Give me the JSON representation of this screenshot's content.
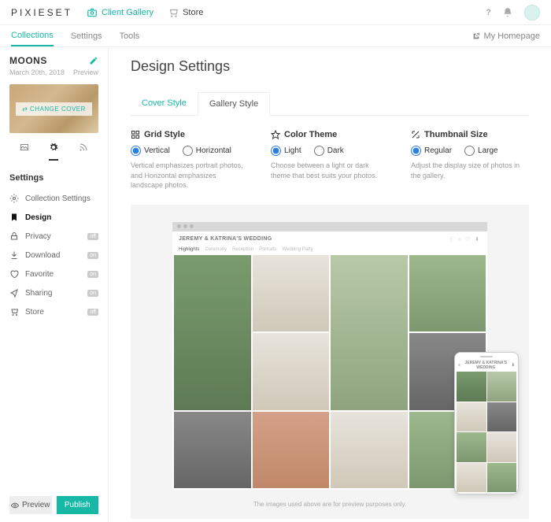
{
  "brand": "PIXIESET",
  "topnav": {
    "client_gallery": "Client Gallery",
    "store": "Store"
  },
  "help_icon": "?",
  "homepage_link": "My Homepage",
  "tabs": {
    "collections": "Collections",
    "settings": "Settings",
    "tools": "Tools"
  },
  "collection": {
    "title": "MOONS",
    "date": "March 20th, 2018",
    "preview_label": "Preview",
    "change_cover": "CHANGE COVER"
  },
  "sidebar": {
    "section": "Settings",
    "items": [
      {
        "label": "Collection Settings"
      },
      {
        "label": "Design"
      },
      {
        "label": "Privacy",
        "badge": "off"
      },
      {
        "label": "Download",
        "badge": "on"
      },
      {
        "label": "Favorite",
        "badge": "on"
      },
      {
        "label": "Sharing",
        "badge": "on"
      },
      {
        "label": "Store",
        "badge": "off"
      }
    ]
  },
  "footer": {
    "preview": "Preview",
    "publish": "Publish"
  },
  "page": {
    "title": "Design Settings"
  },
  "subtabs": {
    "cover": "Cover Style",
    "gallery": "Gallery Style"
  },
  "options": {
    "grid": {
      "title": "Grid Style",
      "opt1": "Vertical",
      "opt2": "Horizontal",
      "desc": "Vertical emphasizes portrait photos, and Horizontal emphasizes landscape photos."
    },
    "color": {
      "title": "Color Theme",
      "opt1": "Light",
      "opt2": "Dark",
      "desc": "Choose between a light or dark theme that best suits your photos."
    },
    "thumb": {
      "title": "Thumbnail Size",
      "opt1": "Regular",
      "opt2": "Large",
      "desc": "Adjust the display size of photos in the gallery."
    }
  },
  "preview": {
    "site_title": "JEREMY & KATRINA'S WEDDING",
    "nav": [
      "Highlights",
      "Ceremony",
      "Reception",
      "Portraits",
      "Wedding Party"
    ],
    "disclaimer": "The images used above are for preview purposes only."
  }
}
